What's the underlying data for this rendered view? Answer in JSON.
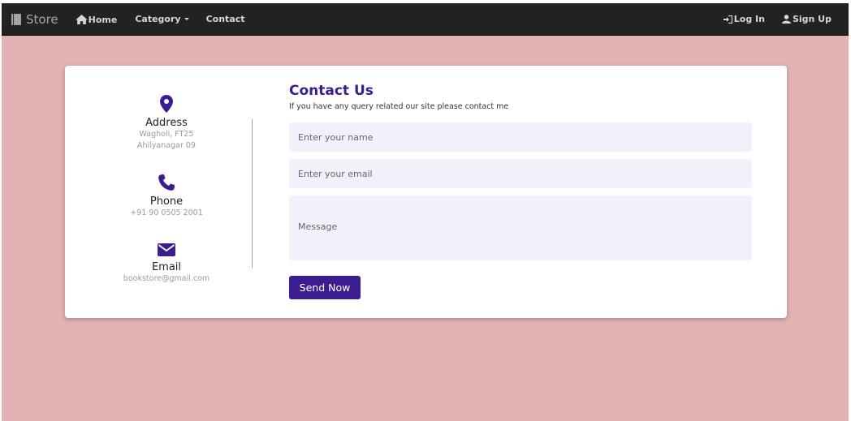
{
  "nav": {
    "brand": "Store",
    "home": "Home",
    "category": "Category",
    "contact": "Contact",
    "login": "Log In",
    "signup": "Sign Up"
  },
  "contact_info": {
    "address": {
      "title": "Address",
      "line1": "Wagholi, FT25",
      "line2": "Ahilyanagar 09"
    },
    "phone": {
      "title": "Phone",
      "value": "+91 90 0505 2001"
    },
    "email": {
      "title": "Email",
      "value": "bookstore@gmail.com"
    }
  },
  "form": {
    "title": "Contact Us",
    "subtitle": "If you have any query related our site please contact me",
    "name_placeholder": "Enter your name",
    "email_placeholder": "Enter your email",
    "message_placeholder": "Message",
    "submit": "Send Now"
  },
  "colors": {
    "background": "#e1b3b3",
    "navbar": "#222222",
    "accent": "#3b1d8f",
    "field_bg": "#f0f1fa"
  }
}
